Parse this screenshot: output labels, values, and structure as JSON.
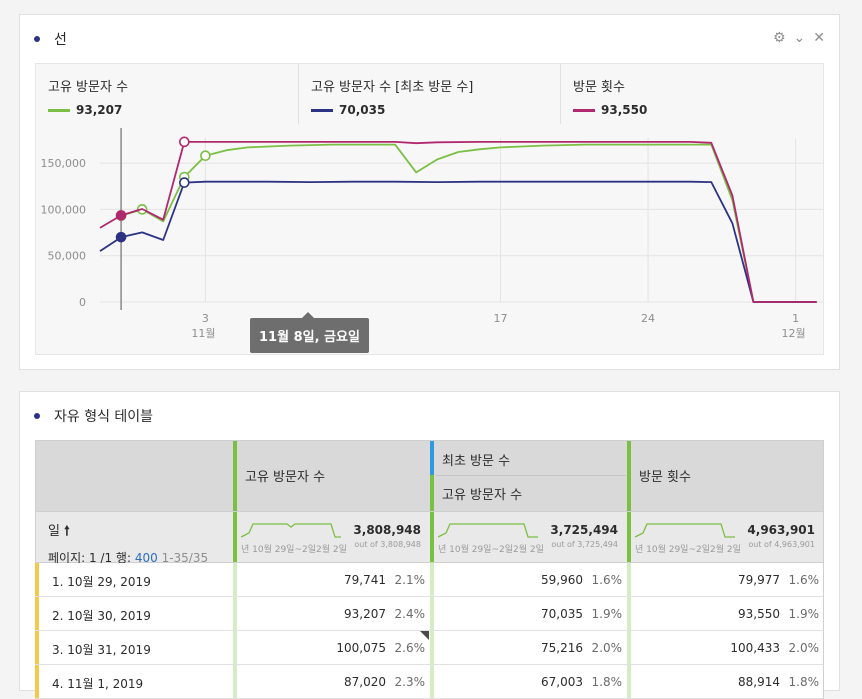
{
  "line_panel": {
    "title": "선",
    "controls": {
      "settings_icon": "gear-icon",
      "collapse_icon": "chevron-down-icon",
      "close_icon": "close-icon"
    },
    "legend": [
      {
        "name": "고유 방문자 수",
        "value": "93,207",
        "color": "#7bbf44"
      },
      {
        "name": "고유 방문자 수 [최초 방문 수]",
        "value": "70,035",
        "color": "#2d3383"
      },
      {
        "name": "방문 횟수",
        "value": "93,550",
        "color": "#b0286d"
      }
    ],
    "tooltip": "11월 8일, 금요일"
  },
  "chart_data": {
    "type": "line",
    "x_unit": "day",
    "x_ticks": [
      {
        "day": 5,
        "label": "3",
        "sub": "11월"
      },
      {
        "day": 19,
        "label": "17",
        "sub": ""
      },
      {
        "day": 26,
        "label": "24",
        "sub": ""
      },
      {
        "day": 33,
        "label": "1",
        "sub": "12월"
      }
    ],
    "y_ticks": [
      {
        "value": 0,
        "label": "0"
      },
      {
        "value": 50000,
        "label": "50,000"
      },
      {
        "value": 100000,
        "label": "100,000"
      },
      {
        "value": 150000,
        "label": "150,000"
      }
    ],
    "ylim": [
      0,
      175000
    ],
    "xlim": [
      0,
      34.3
    ],
    "grid": true,
    "cursor_day": 1,
    "series": [
      {
        "name": "고유 방문자 수",
        "color": "#7bbf44",
        "points": [
          [
            1,
            93207
          ],
          [
            2,
            100075
          ],
          [
            3,
            87020
          ],
          [
            4,
            135000
          ],
          [
            5,
            158000
          ],
          [
            6,
            164000
          ],
          [
            7,
            167000
          ],
          [
            8,
            168000
          ],
          [
            9,
            169000
          ],
          [
            10,
            169500
          ],
          [
            11,
            170000
          ],
          [
            12,
            170000
          ],
          [
            13,
            170000
          ],
          [
            14,
            170000
          ],
          [
            15,
            140000
          ],
          [
            16,
            154000
          ],
          [
            17,
            162000
          ],
          [
            18,
            165000
          ],
          [
            19,
            167000
          ],
          [
            20,
            168000
          ],
          [
            21,
            169000
          ],
          [
            22,
            169500
          ],
          [
            23,
            170000
          ],
          [
            24,
            170000
          ],
          [
            25,
            170000
          ],
          [
            26,
            170000
          ],
          [
            27,
            170000
          ],
          [
            28,
            170000
          ],
          [
            29,
            170000
          ],
          [
            30,
            110000
          ],
          [
            31,
            0
          ],
          [
            32,
            0
          ],
          [
            33,
            0
          ],
          [
            34,
            0
          ]
        ],
        "markers": [
          [
            1,
            93207,
            "filled"
          ],
          [
            2,
            100075,
            "open"
          ],
          [
            4,
            135000,
            "open"
          ],
          [
            5,
            158000,
            "open"
          ]
        ]
      },
      {
        "name": "고유 방문자 수 [최초 방문 수]",
        "color": "#2d3383",
        "points": [
          [
            0,
            55000
          ],
          [
            1,
            70035
          ],
          [
            2,
            75216
          ],
          [
            3,
            67003
          ],
          [
            4,
            129000
          ],
          [
            5,
            130000
          ],
          [
            6,
            130000
          ],
          [
            8,
            130000
          ],
          [
            10,
            129500
          ],
          [
            12,
            130000
          ],
          [
            14,
            130000
          ],
          [
            16,
            129500
          ],
          [
            18,
            130000
          ],
          [
            20,
            130000
          ],
          [
            22,
            130000
          ],
          [
            24,
            130000
          ],
          [
            26,
            130000
          ],
          [
            28,
            130000
          ],
          [
            29,
            129500
          ],
          [
            30,
            85000
          ],
          [
            31,
            0
          ],
          [
            32,
            0
          ],
          [
            33,
            0
          ],
          [
            34,
            0
          ]
        ],
        "markers": [
          [
            1,
            70035,
            "filled"
          ],
          [
            4,
            129000,
            "open"
          ]
        ]
      },
      {
        "name": "방문 횟수",
        "color": "#b0286d",
        "points": [
          [
            0,
            80000
          ],
          [
            1,
            93550
          ],
          [
            2,
            100433
          ],
          [
            3,
            88914
          ],
          [
            4,
            173000
          ],
          [
            6,
            173000
          ],
          [
            8,
            173000
          ],
          [
            10,
            173000
          ],
          [
            12,
            173000
          ],
          [
            14,
            173000
          ],
          [
            15,
            171500
          ],
          [
            16,
            172500
          ],
          [
            18,
            173000
          ],
          [
            20,
            173000
          ],
          [
            22,
            173000
          ],
          [
            24,
            173000
          ],
          [
            26,
            173000
          ],
          [
            28,
            173000
          ],
          [
            29,
            172000
          ],
          [
            30,
            115000
          ],
          [
            31,
            0
          ],
          [
            32,
            0
          ],
          [
            33,
            0
          ],
          [
            34,
            0
          ]
        ],
        "markers": [
          [
            1,
            93550,
            "filled"
          ],
          [
            4,
            173000,
            "open"
          ]
        ]
      }
    ]
  },
  "table_panel": {
    "title": "자유 형식 테이블",
    "headers": {
      "col1": "고유 방문자 수",
      "col2_segment": "최초 방문 수",
      "col2": "고유 방문자 수",
      "col3": "방문 횟수"
    },
    "summary": {
      "dimension_label": "일",
      "sort_icon": "arrow-up-icon",
      "pager_prefix": "페이지: 1 /1 행: ",
      "rows_per_page": "400",
      "range": "1-35/35",
      "columns": [
        {
          "total": "3,808,948",
          "outof": "out of 3,808,948",
          "spark_label": "년 10월 29일~2일2월 2일"
        },
        {
          "total": "3,725,494",
          "outof": "out of 3,725,494",
          "spark_label": "년 10월 29일~2일2월 2일"
        },
        {
          "total": "4,963,901",
          "outof": "out of 4,963,901",
          "spark_label": "년 10월 29일~2일2월 2일"
        }
      ]
    },
    "rows": [
      {
        "label": "1. 10월 29, 2019",
        "c1": "79,741",
        "p1": "2.1%",
        "c2": "59,960",
        "p2": "1.6%",
        "c3": "79,977",
        "p3": "1.6%"
      },
      {
        "label": "2. 10월 30, 2019",
        "c1": "93,207",
        "p1": "2.4%",
        "c2": "70,035",
        "p2": "1.9%",
        "c3": "93,550",
        "p3": "1.9%"
      },
      {
        "label": "3. 10월 31, 2019",
        "c1": "100,075",
        "p1": "2.6%",
        "c2": "75,216",
        "p2": "2.0%",
        "c3": "100,433",
        "p3": "2.0%"
      },
      {
        "label": "4. 11월 1, 2019",
        "c1": "87,020",
        "p1": "2.3%",
        "c2": "67,003",
        "p2": "1.8%",
        "c3": "88,914",
        "p3": "1.8%"
      }
    ]
  }
}
